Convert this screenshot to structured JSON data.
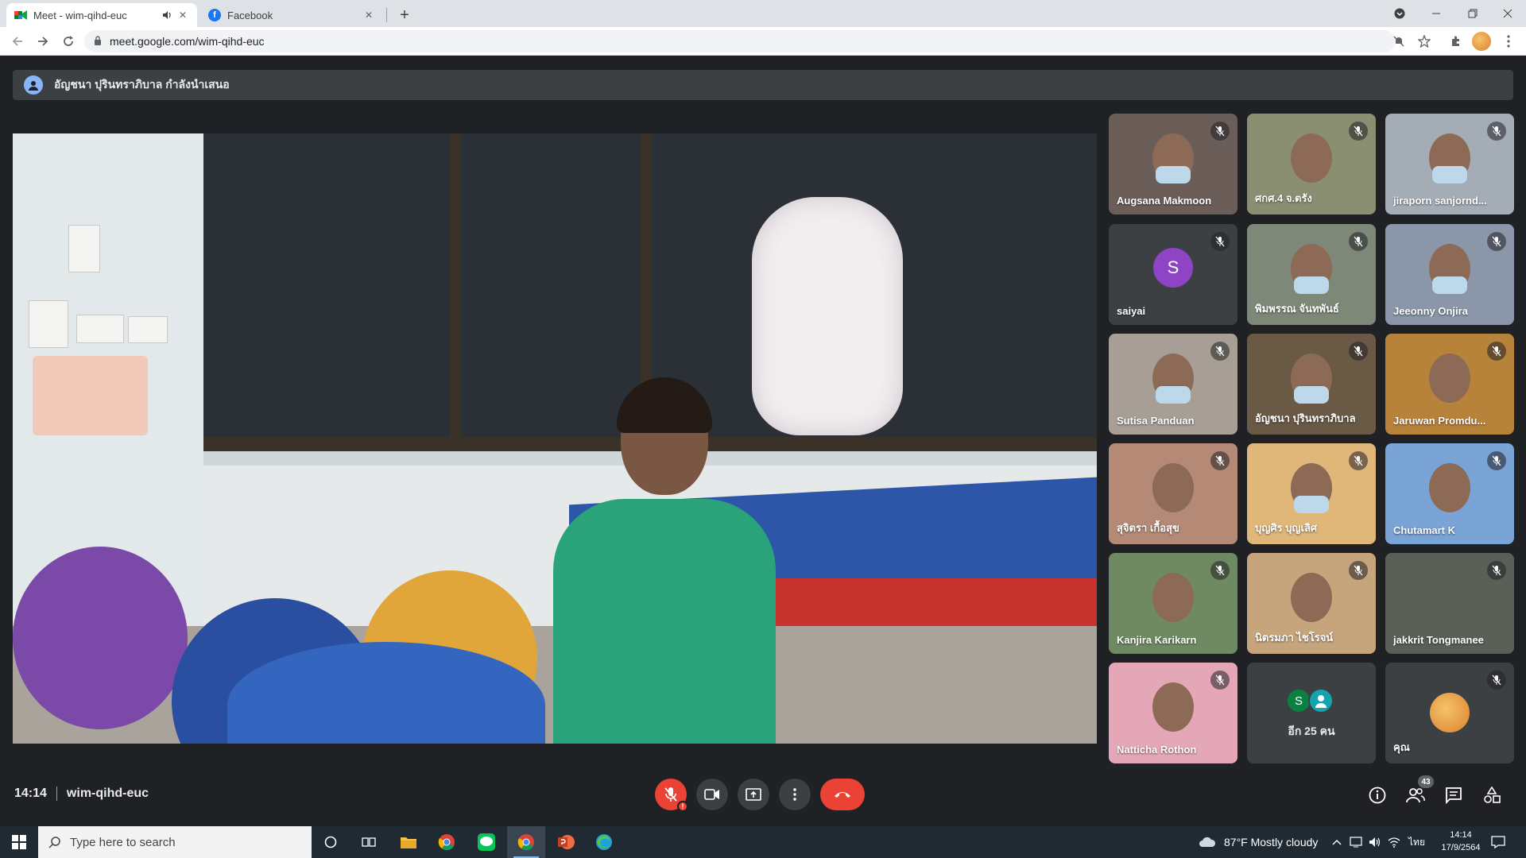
{
  "browser": {
    "tabs": [
      {
        "title": "Meet - wim-qihd-euc",
        "favicon": "meet-icon",
        "audio": "speaker-icon",
        "active": true
      },
      {
        "title": "Facebook",
        "favicon": "facebook-icon",
        "active": false
      }
    ],
    "new_tab_icon": "+",
    "url": "meet.google.com/wim-qihd-euc"
  },
  "meet": {
    "presenting_text": "อัญชนา ปุรินทราภิบาล กำลังนำเสนอ",
    "meeting_time": "14:14",
    "meeting_code": "wim-qihd-euc",
    "people_count": "43",
    "participants": [
      {
        "name": "Augsana Makmoon",
        "muted": true,
        "bg": "#6b5d58"
      },
      {
        "name": "ศกศ.4 จ.ตรัง",
        "muted": true,
        "bg": "#8a8f72"
      },
      {
        "name": "jiraporn sanjornd...",
        "muted": true,
        "bg": "#a4acb6"
      },
      {
        "name": "saiyai",
        "muted": true,
        "bg": "#3c4043",
        "avatar_letter": "S"
      },
      {
        "name": "พิมพรรณ จันทพันธ์",
        "muted": true,
        "bg": "#7e8878"
      },
      {
        "name": "Jeeonny Onjira",
        "muted": true,
        "bg": "#8b97a8"
      },
      {
        "name": "Sutisa Panduan",
        "muted": true,
        "bg": "#a79f96"
      },
      {
        "name": "อัญชนา ปุรินทราภิบาล",
        "muted": true,
        "bg": "#6a5945"
      },
      {
        "name": "Jaruwan Promdu...",
        "muted": true,
        "bg": "#b7823a"
      },
      {
        "name": "สุจิตรา เกื้อสุข",
        "muted": true,
        "bg": "#b48a76"
      },
      {
        "name": "บุญศิร บุญเลิศ",
        "muted": true,
        "bg": "#e0b679"
      },
      {
        "name": "Chutamart K",
        "muted": true,
        "bg": "#7aa3d6"
      },
      {
        "name": "Kanjira Karikarn",
        "muted": true,
        "bg": "#6f8a62"
      },
      {
        "name": "นิตรมภา ไชโรจน์",
        "muted": true,
        "bg": "#c7a57c"
      },
      {
        "name": "jakkrit Tongmanee",
        "muted": true,
        "bg": "#5a5f58"
      },
      {
        "name": "Natticha Rothon",
        "muted": true,
        "bg": "#e4a7b8"
      }
    ],
    "more_tile": {
      "label": "อีก 25 คน",
      "avatar_letter": "S"
    },
    "self_tile": {
      "name": "คุณ",
      "muted": true
    }
  },
  "taskbar": {
    "search_placeholder": "Type here to search",
    "weather": "87°F  Mostly cloudy",
    "language": "ไทย",
    "time": "14:14",
    "date": "17/9/2564"
  }
}
